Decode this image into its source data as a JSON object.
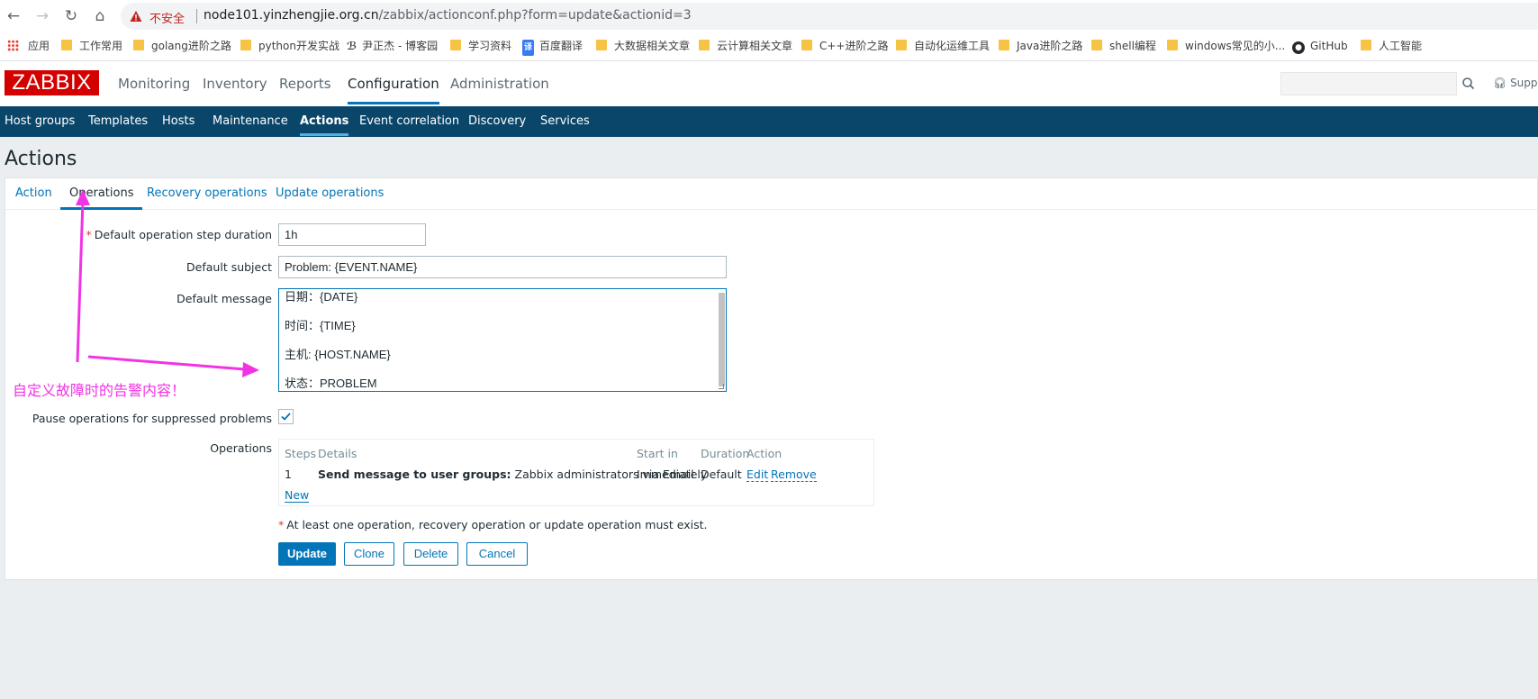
{
  "browser": {
    "security_warning": "不安全",
    "url_host": "node101.yinzhengjie.org.cn",
    "url_path": "/zabbix/actionconf.php?form=update&actionid=3",
    "bookmarks": [
      {
        "label": "应用",
        "icon": "apps-grid-icon"
      },
      {
        "label": "工作常用",
        "icon": "folder-icon"
      },
      {
        "label": "golang进阶之路",
        "icon": "folder-icon"
      },
      {
        "label": "python开发实战",
        "icon": "folder-icon"
      },
      {
        "label": "尹正杰 - 博客园",
        "icon": "cnblogs-icon"
      },
      {
        "label": "学习资料",
        "icon": "folder-icon"
      },
      {
        "label": "百度翻译",
        "icon": "translate-icon"
      },
      {
        "label": "大数据相关文章",
        "icon": "folder-icon"
      },
      {
        "label": "云计算相关文章",
        "icon": "folder-icon"
      },
      {
        "label": "C++进阶之路",
        "icon": "folder-icon"
      },
      {
        "label": "自动化运维工具",
        "icon": "folder-icon"
      },
      {
        "label": "Java进阶之路",
        "icon": "folder-icon"
      },
      {
        "label": "shell编程",
        "icon": "folder-icon"
      },
      {
        "label": "windows常见的小...",
        "icon": "folder-icon"
      },
      {
        "label": "GitHub",
        "icon": "github-icon"
      },
      {
        "label": "人工智能",
        "icon": "folder-icon"
      }
    ]
  },
  "header": {
    "logo": "ZABBIX",
    "nav": [
      "Monitoring",
      "Inventory",
      "Reports",
      "Configuration",
      "Administration"
    ],
    "active_nav": "Configuration",
    "support": "Support"
  },
  "subnav": {
    "items": [
      "Host groups",
      "Templates",
      "Hosts",
      "Maintenance",
      "Actions",
      "Event correlation",
      "Discovery",
      "Services"
    ],
    "active": "Actions"
  },
  "page": {
    "title": "Actions",
    "tabs": [
      "Action",
      "Operations",
      "Recovery operations",
      "Update operations"
    ],
    "active_tab": "Operations"
  },
  "form": {
    "step_duration_label": "Default operation step duration",
    "step_duration_value": "1h",
    "subject_label": "Default subject",
    "subject_value": "Problem: {EVENT.NAME}",
    "message_label": "Default message",
    "message_lines": [
      "日期：{DATE}",
      "时间：{TIME}",
      "主机: {HOST.NAME}",
      "状态：PROBLEM"
    ],
    "pause_label": "Pause operations for suppressed problems",
    "pause_checked": true,
    "operations_label": "Operations",
    "operations_table": {
      "headers": [
        "Steps",
        "Details",
        "Start in",
        "Duration",
        "Action"
      ],
      "rows": [
        {
          "steps": "1",
          "details_bold": "Send message to user groups:",
          "details_rest": "Zabbix administrators via Email",
          "start_in": "Immediately",
          "duration": "Default",
          "edit": "Edit",
          "remove": "Remove"
        }
      ],
      "new_link": "New"
    },
    "note": "At least one operation, recovery operation or update operation must exist.",
    "buttons": {
      "update": "Update",
      "clone": "Clone",
      "delete": "Delete",
      "cancel": "Cancel"
    }
  },
  "annotation": {
    "text": "自定义故障时的告警内容！",
    "color": "#f233e4"
  },
  "colors": {
    "brand_red": "#d40000",
    "subnav_bg": "#0a466a",
    "link_blue": "#0275b8"
  }
}
